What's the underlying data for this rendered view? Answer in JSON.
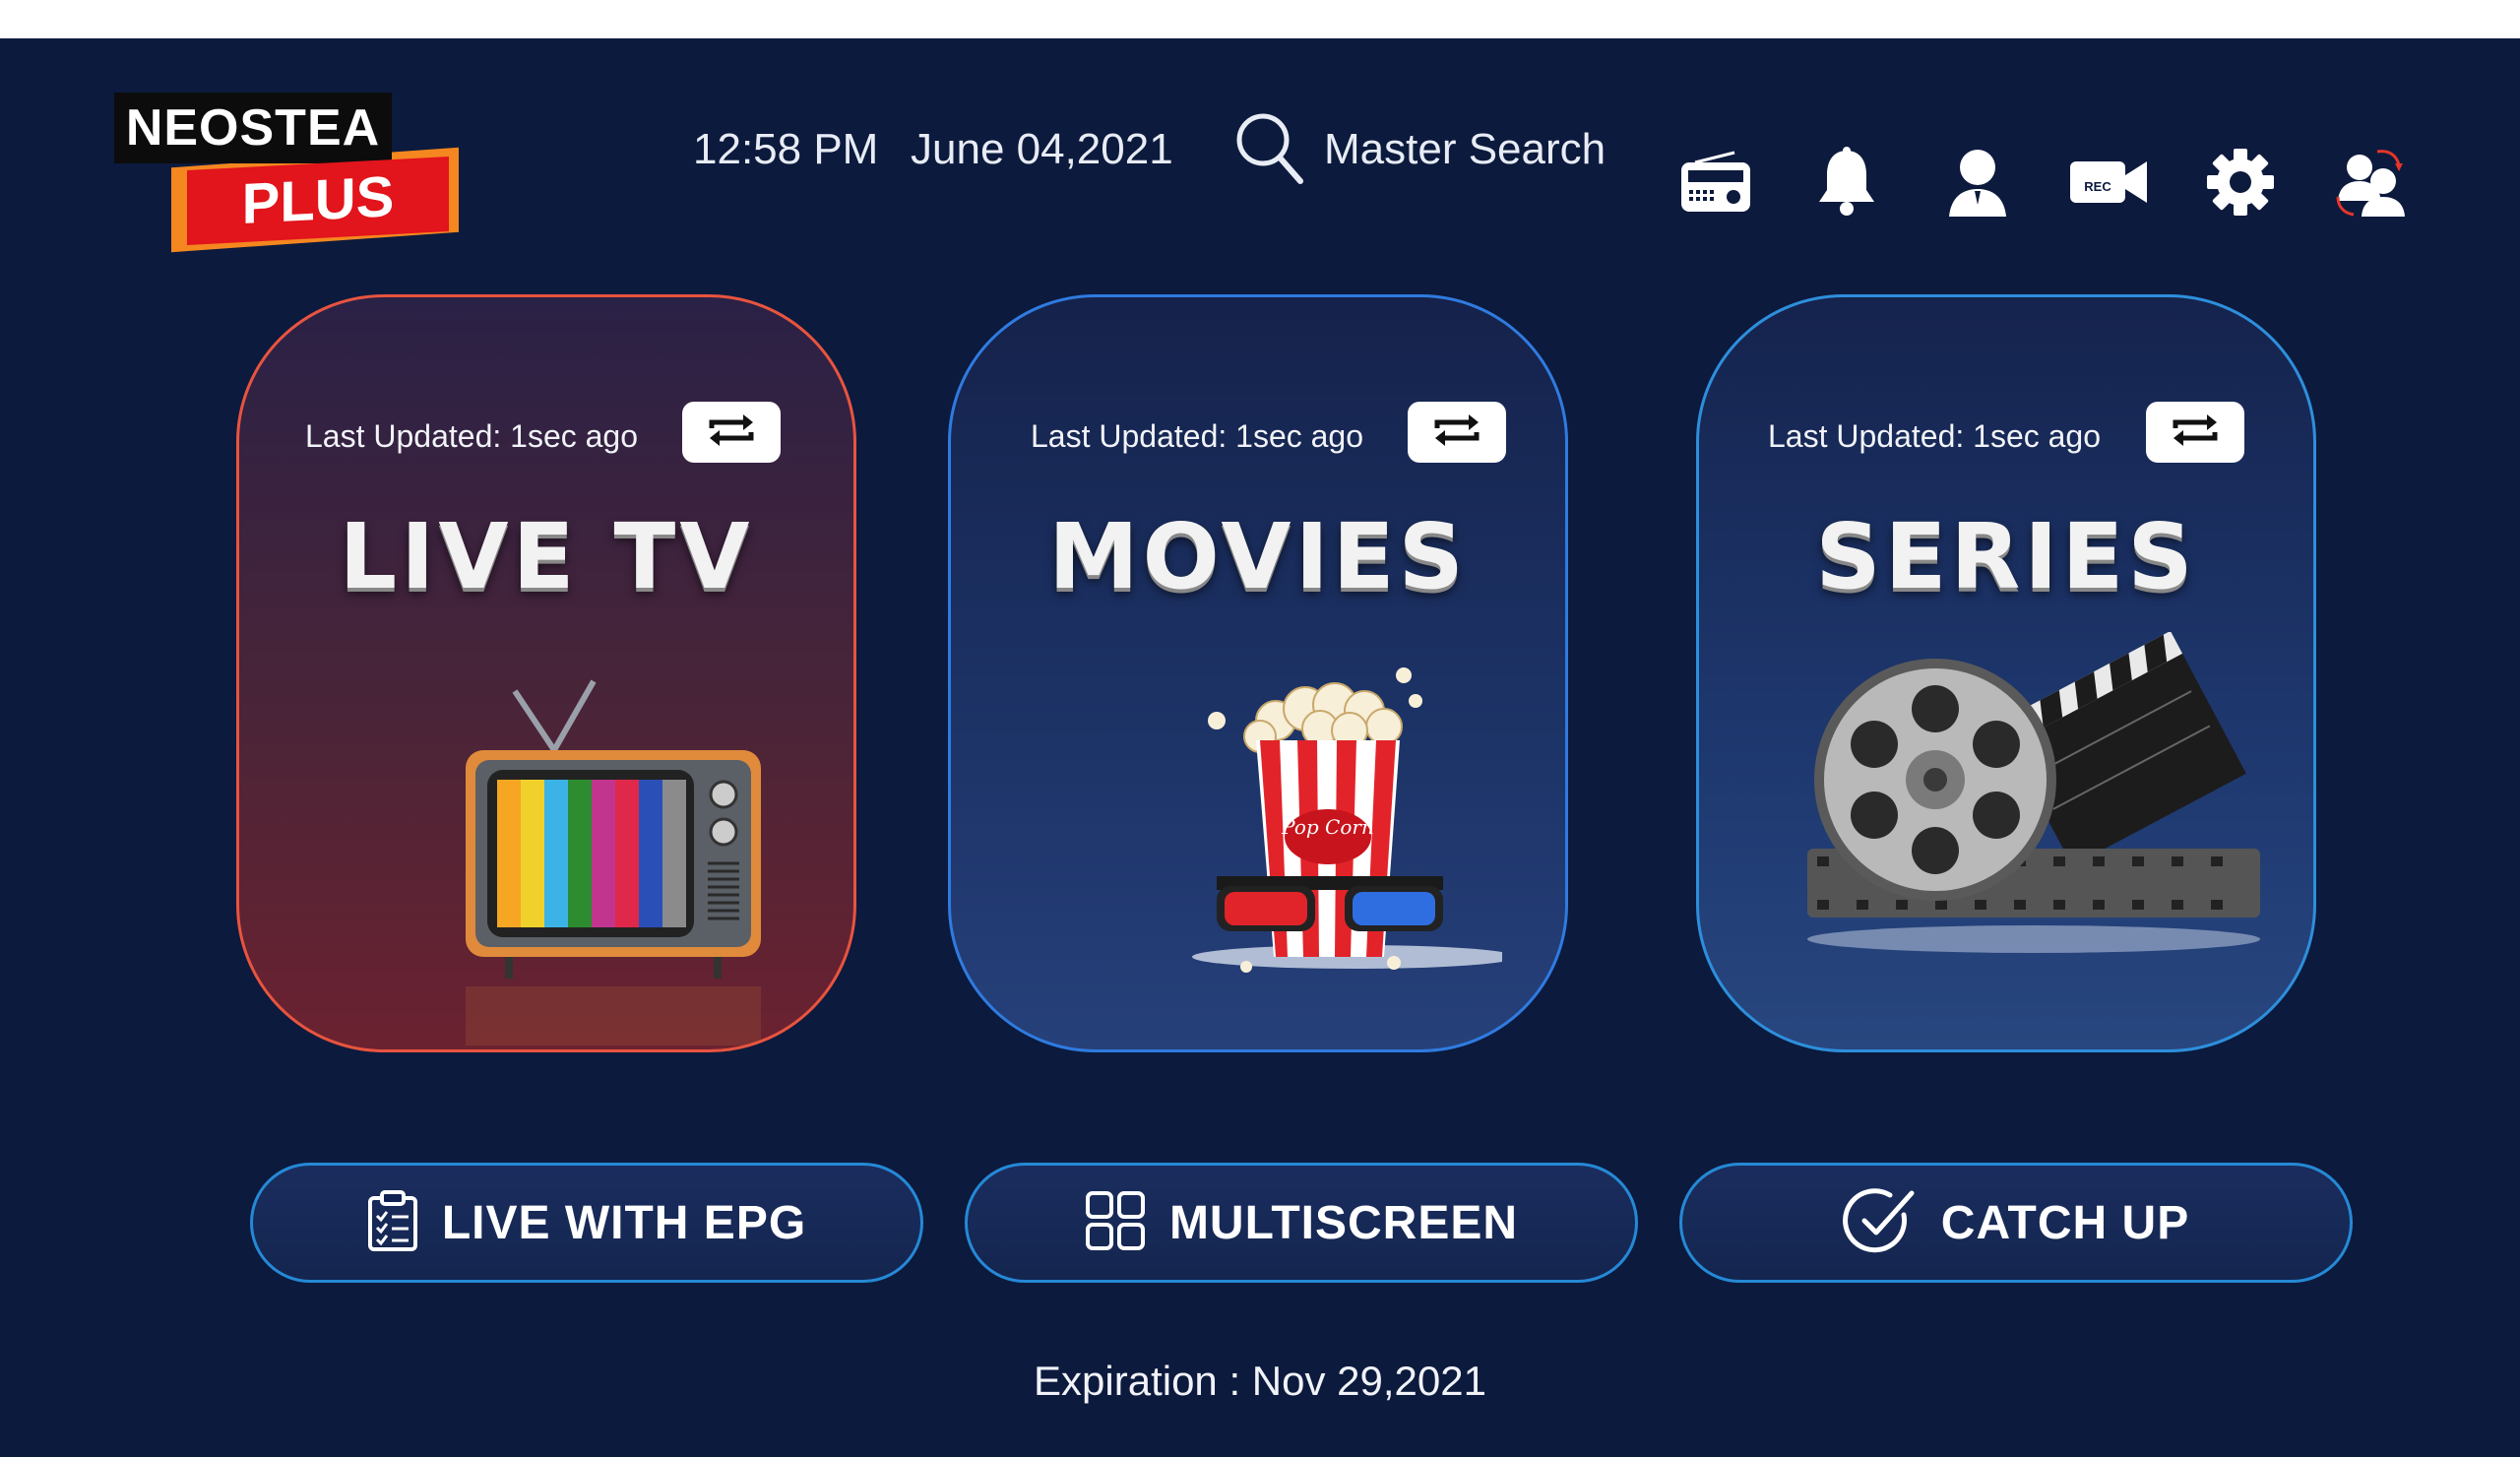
{
  "logo": {
    "line1": "NEOSTEA",
    "line2": "PLUS"
  },
  "header": {
    "time": "12:58 PM",
    "date": "June 04,2021",
    "search_label": "Master Search",
    "icons": [
      "radio-icon",
      "bell-icon",
      "user-icon",
      "rec-camera-icon",
      "gear-icon",
      "switch-user-icon"
    ],
    "rec_text": "REC"
  },
  "cards": [
    {
      "title": "LIVE TV",
      "last_updated": "Last Updated: 1sec ago"
    },
    {
      "title": "MOVIES",
      "last_updated": "Last Updated: 1sec ago"
    },
    {
      "title": "SERIES",
      "last_updated": "Last Updated: 1sec ago"
    }
  ],
  "popcorn_label": "Pop Corn",
  "bottom_buttons": [
    {
      "label": "LIVE WITH EPG",
      "icon": "clipboard-checklist-icon"
    },
    {
      "label": "MULTISCREEN",
      "icon": "grid-icon"
    },
    {
      "label": "CATCH UP",
      "icon": "check-circle-icon"
    }
  ],
  "expiration": "Expiration : Nov 29,2021",
  "colors": {
    "background": "#0c1a3d",
    "live_border": "#e8543f",
    "movies_border": "#2f7be0",
    "series_border": "#2d8fdc",
    "logo_red": "#e2141c",
    "logo_orange": "#f4871f"
  }
}
